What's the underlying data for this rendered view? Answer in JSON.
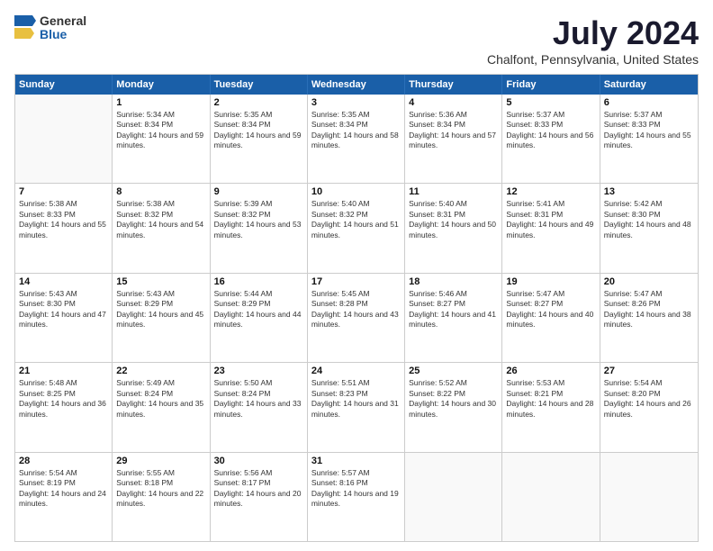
{
  "logo": {
    "general": "General",
    "blue": "Blue"
  },
  "title": "July 2024",
  "subtitle": "Chalfont, Pennsylvania, United States",
  "header_days": [
    "Sunday",
    "Monday",
    "Tuesday",
    "Wednesday",
    "Thursday",
    "Friday",
    "Saturday"
  ],
  "weeks": [
    [
      {
        "day": "",
        "sunrise": "",
        "sunset": "",
        "daylight": ""
      },
      {
        "day": "1",
        "sunrise": "Sunrise: 5:34 AM",
        "sunset": "Sunset: 8:34 PM",
        "daylight": "Daylight: 14 hours and 59 minutes."
      },
      {
        "day": "2",
        "sunrise": "Sunrise: 5:35 AM",
        "sunset": "Sunset: 8:34 PM",
        "daylight": "Daylight: 14 hours and 59 minutes."
      },
      {
        "day": "3",
        "sunrise": "Sunrise: 5:35 AM",
        "sunset": "Sunset: 8:34 PM",
        "daylight": "Daylight: 14 hours and 58 minutes."
      },
      {
        "day": "4",
        "sunrise": "Sunrise: 5:36 AM",
        "sunset": "Sunset: 8:34 PM",
        "daylight": "Daylight: 14 hours and 57 minutes."
      },
      {
        "day": "5",
        "sunrise": "Sunrise: 5:37 AM",
        "sunset": "Sunset: 8:33 PM",
        "daylight": "Daylight: 14 hours and 56 minutes."
      },
      {
        "day": "6",
        "sunrise": "Sunrise: 5:37 AM",
        "sunset": "Sunset: 8:33 PM",
        "daylight": "Daylight: 14 hours and 55 minutes."
      }
    ],
    [
      {
        "day": "7",
        "sunrise": "Sunrise: 5:38 AM",
        "sunset": "Sunset: 8:33 PM",
        "daylight": "Daylight: 14 hours and 55 minutes."
      },
      {
        "day": "8",
        "sunrise": "Sunrise: 5:38 AM",
        "sunset": "Sunset: 8:32 PM",
        "daylight": "Daylight: 14 hours and 54 minutes."
      },
      {
        "day": "9",
        "sunrise": "Sunrise: 5:39 AM",
        "sunset": "Sunset: 8:32 PM",
        "daylight": "Daylight: 14 hours and 53 minutes."
      },
      {
        "day": "10",
        "sunrise": "Sunrise: 5:40 AM",
        "sunset": "Sunset: 8:32 PM",
        "daylight": "Daylight: 14 hours and 51 minutes."
      },
      {
        "day": "11",
        "sunrise": "Sunrise: 5:40 AM",
        "sunset": "Sunset: 8:31 PM",
        "daylight": "Daylight: 14 hours and 50 minutes."
      },
      {
        "day": "12",
        "sunrise": "Sunrise: 5:41 AM",
        "sunset": "Sunset: 8:31 PM",
        "daylight": "Daylight: 14 hours and 49 minutes."
      },
      {
        "day": "13",
        "sunrise": "Sunrise: 5:42 AM",
        "sunset": "Sunset: 8:30 PM",
        "daylight": "Daylight: 14 hours and 48 minutes."
      }
    ],
    [
      {
        "day": "14",
        "sunrise": "Sunrise: 5:43 AM",
        "sunset": "Sunset: 8:30 PM",
        "daylight": "Daylight: 14 hours and 47 minutes."
      },
      {
        "day": "15",
        "sunrise": "Sunrise: 5:43 AM",
        "sunset": "Sunset: 8:29 PM",
        "daylight": "Daylight: 14 hours and 45 minutes."
      },
      {
        "day": "16",
        "sunrise": "Sunrise: 5:44 AM",
        "sunset": "Sunset: 8:29 PM",
        "daylight": "Daylight: 14 hours and 44 minutes."
      },
      {
        "day": "17",
        "sunrise": "Sunrise: 5:45 AM",
        "sunset": "Sunset: 8:28 PM",
        "daylight": "Daylight: 14 hours and 43 minutes."
      },
      {
        "day": "18",
        "sunrise": "Sunrise: 5:46 AM",
        "sunset": "Sunset: 8:27 PM",
        "daylight": "Daylight: 14 hours and 41 minutes."
      },
      {
        "day": "19",
        "sunrise": "Sunrise: 5:47 AM",
        "sunset": "Sunset: 8:27 PM",
        "daylight": "Daylight: 14 hours and 40 minutes."
      },
      {
        "day": "20",
        "sunrise": "Sunrise: 5:47 AM",
        "sunset": "Sunset: 8:26 PM",
        "daylight": "Daylight: 14 hours and 38 minutes."
      }
    ],
    [
      {
        "day": "21",
        "sunrise": "Sunrise: 5:48 AM",
        "sunset": "Sunset: 8:25 PM",
        "daylight": "Daylight: 14 hours and 36 minutes."
      },
      {
        "day": "22",
        "sunrise": "Sunrise: 5:49 AM",
        "sunset": "Sunset: 8:24 PM",
        "daylight": "Daylight: 14 hours and 35 minutes."
      },
      {
        "day": "23",
        "sunrise": "Sunrise: 5:50 AM",
        "sunset": "Sunset: 8:24 PM",
        "daylight": "Daylight: 14 hours and 33 minutes."
      },
      {
        "day": "24",
        "sunrise": "Sunrise: 5:51 AM",
        "sunset": "Sunset: 8:23 PM",
        "daylight": "Daylight: 14 hours and 31 minutes."
      },
      {
        "day": "25",
        "sunrise": "Sunrise: 5:52 AM",
        "sunset": "Sunset: 8:22 PM",
        "daylight": "Daylight: 14 hours and 30 minutes."
      },
      {
        "day": "26",
        "sunrise": "Sunrise: 5:53 AM",
        "sunset": "Sunset: 8:21 PM",
        "daylight": "Daylight: 14 hours and 28 minutes."
      },
      {
        "day": "27",
        "sunrise": "Sunrise: 5:54 AM",
        "sunset": "Sunset: 8:20 PM",
        "daylight": "Daylight: 14 hours and 26 minutes."
      }
    ],
    [
      {
        "day": "28",
        "sunrise": "Sunrise: 5:54 AM",
        "sunset": "Sunset: 8:19 PM",
        "daylight": "Daylight: 14 hours and 24 minutes."
      },
      {
        "day": "29",
        "sunrise": "Sunrise: 5:55 AM",
        "sunset": "Sunset: 8:18 PM",
        "daylight": "Daylight: 14 hours and 22 minutes."
      },
      {
        "day": "30",
        "sunrise": "Sunrise: 5:56 AM",
        "sunset": "Sunset: 8:17 PM",
        "daylight": "Daylight: 14 hours and 20 minutes."
      },
      {
        "day": "31",
        "sunrise": "Sunrise: 5:57 AM",
        "sunset": "Sunset: 8:16 PM",
        "daylight": "Daylight: 14 hours and 19 minutes."
      },
      {
        "day": "",
        "sunrise": "",
        "sunset": "",
        "daylight": ""
      },
      {
        "day": "",
        "sunrise": "",
        "sunset": "",
        "daylight": ""
      },
      {
        "day": "",
        "sunrise": "",
        "sunset": "",
        "daylight": ""
      }
    ]
  ]
}
